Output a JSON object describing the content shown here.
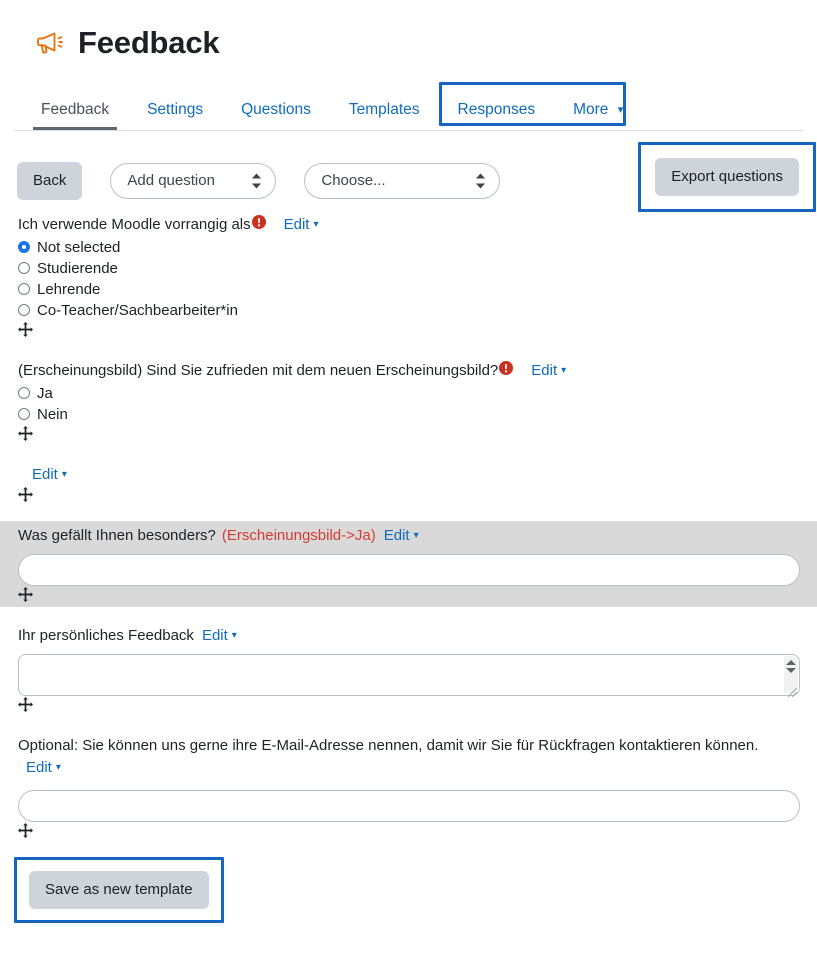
{
  "header": {
    "icon": "megaphone-icon",
    "title": "Feedback",
    "accent_color": "#e8740c"
  },
  "tabs": {
    "highlight_color": "#1565c0",
    "items": [
      {
        "label": "Feedback",
        "active": true,
        "has_caret": false
      },
      {
        "label": "Settings",
        "active": false,
        "has_caret": false
      },
      {
        "label": "Questions",
        "active": false,
        "has_caret": false
      },
      {
        "label": "Templates",
        "active": false,
        "has_caret": false
      },
      {
        "label": "Responses",
        "active": false,
        "has_caret": false,
        "highlighted": true
      },
      {
        "label": "More",
        "active": false,
        "has_caret": true,
        "highlighted": true
      }
    ]
  },
  "toolbar": {
    "back_label": "Back",
    "add_question_value": "Add question",
    "choose_value": "Choose...",
    "export_label": "Export questions"
  },
  "items": [
    {
      "kind": "radio-question",
      "text": "Ich verwende Moodle vorrangig als",
      "required": true,
      "edit_label": "Edit",
      "options": [
        {
          "label": "Not selected",
          "checked": true
        },
        {
          "label": "Studierende",
          "checked": false
        },
        {
          "label": "Lehrende",
          "checked": false
        },
        {
          "label": "Co-Teacher/Sachbearbeiter*in",
          "checked": false
        }
      ],
      "move_handle": "move-icon"
    },
    {
      "kind": "radio-question",
      "text": "(Erscheinungsbild) Sind Sie zufrieden mit dem neuen Erscheinungsbild?",
      "required": true,
      "edit_label": "Edit",
      "options": [
        {
          "label": "Ja",
          "checked": false
        },
        {
          "label": "Nein",
          "checked": false
        }
      ],
      "move_handle": "move-icon"
    },
    {
      "kind": "pagebreak",
      "text": "",
      "required": false,
      "edit_label": "Edit",
      "move_handle": "move-icon"
    },
    {
      "kind": "short-text-question",
      "shaded": true,
      "text": "Was gefällt Ihnen besonders?",
      "dependency": "(Erscheinungsbild->Ja)",
      "required": false,
      "edit_label": "Edit",
      "input_value": "",
      "move_handle": "move-icon"
    },
    {
      "kind": "textarea-question",
      "text": "Ihr persönliches Feedback",
      "required": false,
      "edit_label": "Edit",
      "input_value": "",
      "move_handle": "move-icon"
    },
    {
      "kind": "short-text-question",
      "text": "Optional: Sie können uns gerne ihre E-Mail-Adresse nennen, damit wir Sie für Rückfragen kontaktieren können.",
      "required": false,
      "edit_label": "Edit",
      "edit_on_own_line": true,
      "input_value": "",
      "move_handle": "move-icon"
    }
  ],
  "footer": {
    "save_template_label": "Save as new template",
    "highlight_color": "#1565c0"
  }
}
